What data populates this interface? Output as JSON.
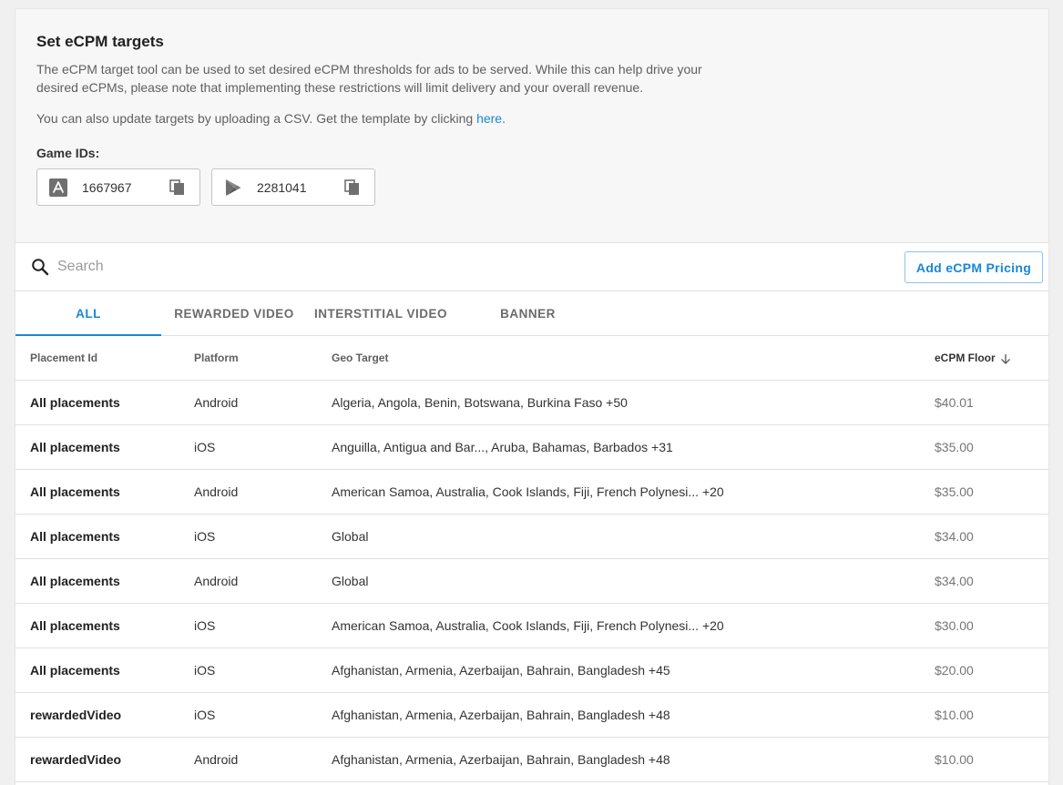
{
  "header": {
    "title": "Set eCPM targets",
    "description": "The eCPM target tool can be used to set desired eCPM thresholds for ads to be served. While this can help drive your desired eCPMs, please note that implementing these restrictions will limit delivery and your overall revenue.",
    "csv_text": "You can also update targets by uploading a CSV. Get the template by clicking ",
    "csv_link": "here",
    "csv_period": ".",
    "game_ids_label": "Game IDs:",
    "game_ids": [
      {
        "platform_icon": "app-store-icon",
        "id": "1667967"
      },
      {
        "platform_icon": "google-play-icon",
        "id": "2281041"
      }
    ]
  },
  "search": {
    "placeholder": "Search",
    "value": ""
  },
  "add_button": "Add eCPM Pricing",
  "tabs": [
    {
      "label": "ALL",
      "active": true
    },
    {
      "label": "REWARDED VIDEO",
      "active": false
    },
    {
      "label": "INTERSTITIAL VIDEO",
      "active": false
    },
    {
      "label": "BANNER",
      "active": false
    }
  ],
  "table": {
    "columns": [
      "Placement Id",
      "Platform",
      "Geo Target",
      "eCPM Floor"
    ],
    "sort_column": "eCPM Floor",
    "sort_direction": "descending",
    "rows": [
      [
        "All placements",
        "Android",
        "Algeria, Angola, Benin, Botswana, Burkina Faso +50",
        "$40.01"
      ],
      [
        "All placements",
        "iOS",
        "Anguilla, Antigua and Bar..., Aruba, Bahamas, Barbados +31",
        "$35.00"
      ],
      [
        "All placements",
        "Android",
        "American Samoa, Australia, Cook Islands, Fiji, French Polynesi... +20",
        "$35.00"
      ],
      [
        "All placements",
        "iOS",
        "Global",
        "$34.00"
      ],
      [
        "All placements",
        "Android",
        "Global",
        "$34.00"
      ],
      [
        "All placements",
        "iOS",
        "American Samoa, Australia, Cook Islands, Fiji, French Polynesi... +20",
        "$30.00"
      ],
      [
        "All placements",
        "iOS",
        "Afghanistan, Armenia, Azerbaijan, Bahrain, Bangladesh +45",
        "$20.00"
      ],
      [
        "rewardedVideo",
        "iOS",
        "Afghanistan, Armenia, Azerbaijan, Bahrain, Bangladesh +48",
        "$10.00"
      ],
      [
        "rewardedVideo",
        "Android",
        "Afghanistan, Armenia, Azerbaijan, Bahrain, Bangladesh +48",
        "$10.00"
      ]
    ]
  },
  "colors": {
    "accent": "#1a87d8",
    "header_bg": "#f7f7f7",
    "page_bg": "#f0f0f0"
  }
}
